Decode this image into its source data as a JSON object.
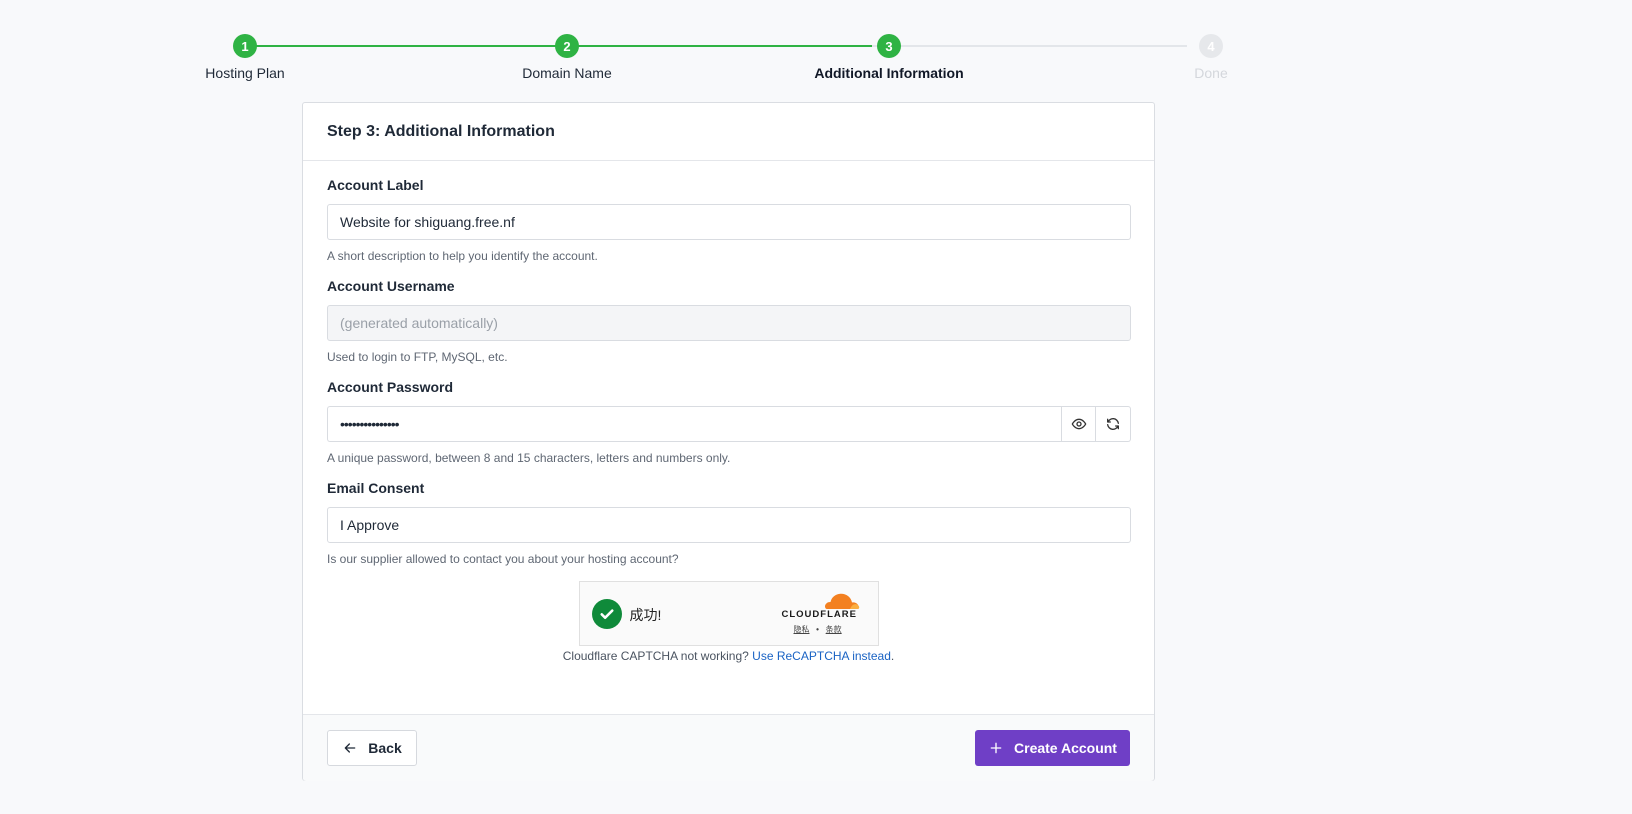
{
  "stepper": {
    "steps": [
      {
        "number": "1",
        "label": "Hosting Plan",
        "state": "complete"
      },
      {
        "number": "2",
        "label": "Domain Name",
        "state": "complete"
      },
      {
        "number": "3",
        "label": "Additional Information",
        "state": "active"
      },
      {
        "number": "4",
        "label": "Done",
        "state": "pending"
      }
    ]
  },
  "card": {
    "title": "Step 3: Additional Information",
    "fields": {
      "label": {
        "label": "Account Label",
        "value": "Website for shiguang.free.nf",
        "hint": "A short description to help you identify the account."
      },
      "username": {
        "label": "Account Username",
        "placeholder": "(generated automatically)",
        "hint": "Used to login to FTP, MySQL, etc."
      },
      "password": {
        "label": "Account Password",
        "value": "•••••••••••••••",
        "hint": "A unique password, between 8 and 15 characters, letters and numbers only."
      },
      "email_consent": {
        "label": "Email Consent",
        "value": "I Approve",
        "hint": "Is our supplier allowed to contact you about your hosting account?"
      }
    },
    "captcha": {
      "status": "成功!",
      "brand": "CLOUDFLARE",
      "privacy": "隐私",
      "separator": "•",
      "terms": "条款",
      "note": "Cloudflare CAPTCHA not working?",
      "link": "Use ReCAPTCHA instead",
      "period": "."
    },
    "footer": {
      "back_label": "Back",
      "create_label": "Create Account"
    }
  },
  "colors": {
    "success": "#2fb344",
    "primary": "#6f3fc6",
    "link": "#1a63c4",
    "cloudflare_orange": "#f38020"
  }
}
